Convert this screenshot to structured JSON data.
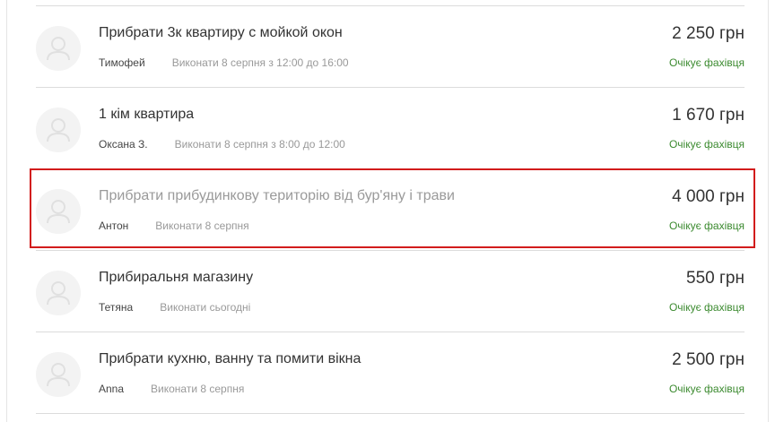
{
  "tasks": [
    {
      "title": "Прибрати 3к квартиру с мойкой окон",
      "client": "Тимофей",
      "when": "Виконати 8 серпня з 12:00 до 16:00",
      "price": "2 250 грн",
      "status": "Очікує фахівця"
    },
    {
      "title": "1 кім квартира",
      "client": "Оксана З.",
      "when": "Виконати 8 серпня з 8:00 до 12:00",
      "price": "1 670 грн",
      "status": "Очікує фахівця"
    },
    {
      "title": "Прибрати прибудинкову територію від бур'яну і трави",
      "client": "Антон",
      "when": "Виконати 8 серпня",
      "price": "4 000 грн",
      "status": "Очікує фахівця"
    },
    {
      "title": "Прибиральня магазину",
      "client": "Тетяна",
      "when": "Виконати сьогодні",
      "price": "550 грн",
      "status": "Очікує фахівця"
    },
    {
      "title": "Прибрати кухню, ванну та помити вікна",
      "client": "Anna",
      "when": "Виконати 8 серпня",
      "price": "2 500 грн",
      "status": "Очікує фахівця"
    }
  ],
  "colors": {
    "status": "#3b8a2f",
    "highlight": "#d21c1c",
    "divider": "#dcdcdc"
  },
  "icons": {
    "avatar": "user-placeholder-icon"
  }
}
